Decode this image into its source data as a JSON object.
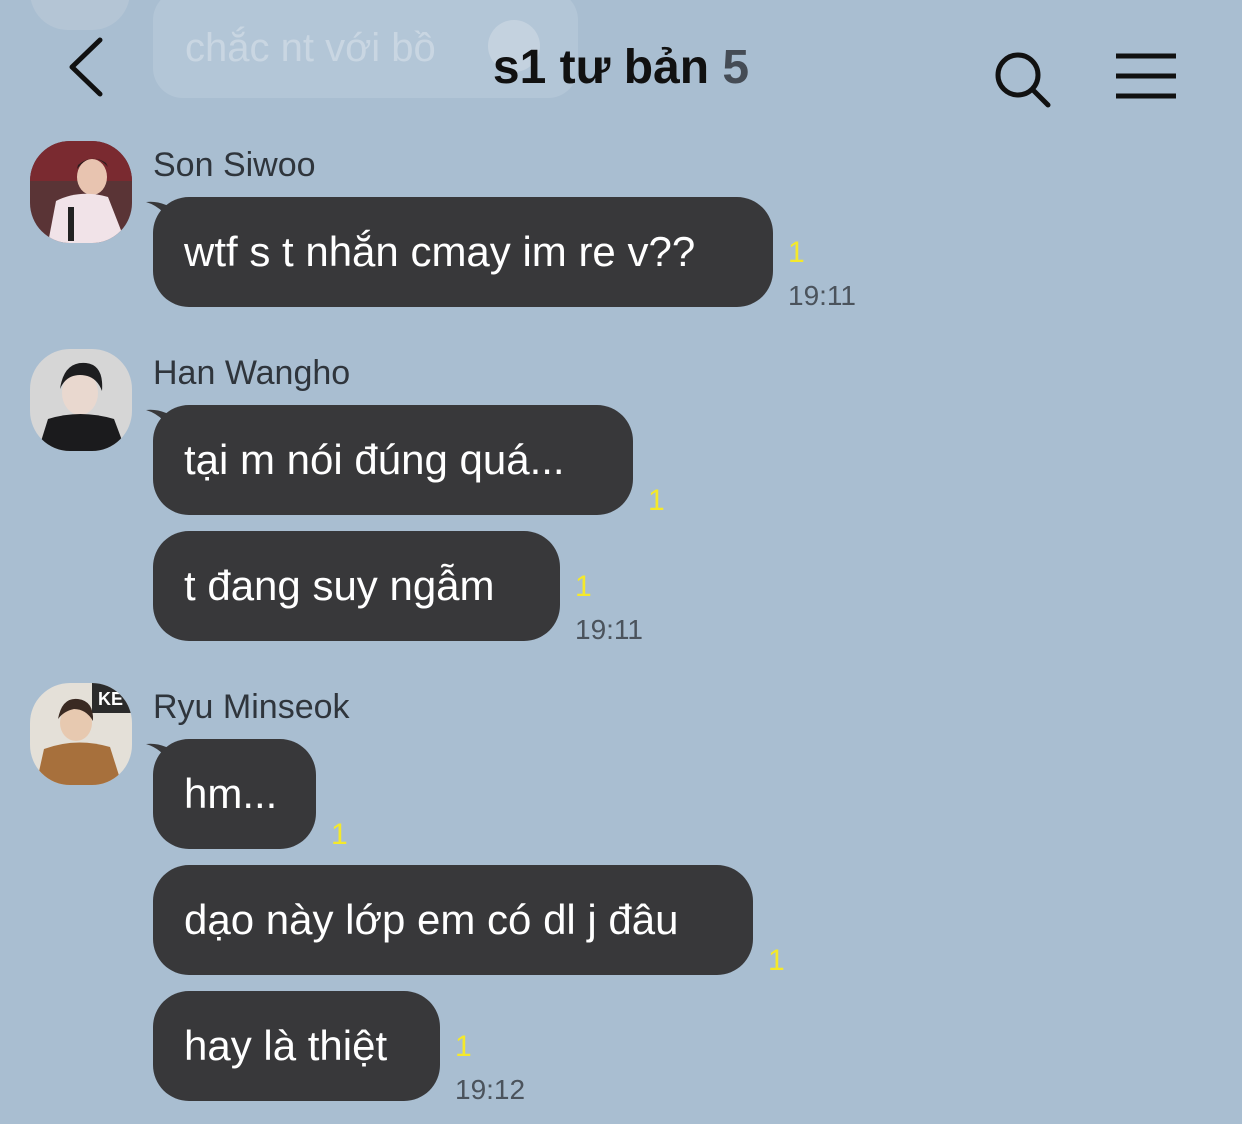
{
  "background_color": "#a9bed1",
  "bubble_color": "#38383a",
  "unread_color": "#f5e92a",
  "header": {
    "title": "s1 tư bản",
    "member_count": "5",
    "back_icon": "chevron-left-icon",
    "search_icon": "search-icon",
    "menu_icon": "hamburger-menu-icon"
  },
  "ghost_message": {
    "text": "chắc nt với bồ"
  },
  "messages": [
    {
      "sender": "Son Siwoo",
      "bubbles": [
        {
          "text": "wtf s t nhắn cmay im re v??",
          "unread": "1"
        }
      ],
      "time": "19:11"
    },
    {
      "sender": "Han Wangho",
      "bubbles": [
        {
          "text": "tại m nói đúng quá...",
          "unread": "1"
        },
        {
          "text": "t đang suy ngẫm",
          "unread": "1"
        }
      ],
      "time": "19:11"
    },
    {
      "sender": "Ryu Minseok",
      "bubbles": [
        {
          "text": "hm...",
          "unread": "1"
        },
        {
          "text": "dạo này lớp em có dl j đâu",
          "unread": "1"
        },
        {
          "text": "hay là thiệt",
          "unread": "1"
        }
      ],
      "time": "19:12"
    }
  ]
}
